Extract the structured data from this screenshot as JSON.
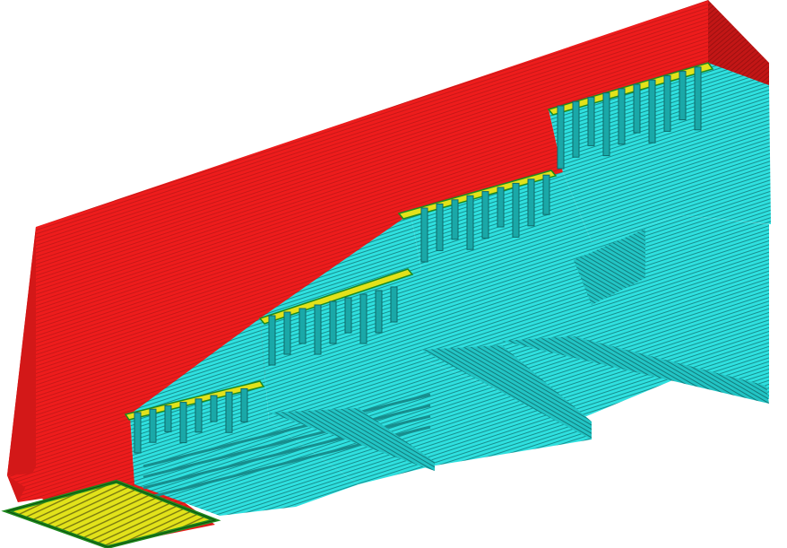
{
  "scene": {
    "description_visible_text": "",
    "colors": {
      "background": "#ffffff",
      "outer_wall": "#ee1c1c",
      "outer_wall_dark": "#b81414",
      "outer_wall_stripe": "#c81818",
      "infill": "#2fe0df",
      "infill_dark": "#1aa8a8",
      "infill_stripe": "#178e8e",
      "top_surface": "#e2e21a",
      "skin_green": "#1e8a1e",
      "skin_dark": "#0f4d0f"
    },
    "step_count": 4
  }
}
